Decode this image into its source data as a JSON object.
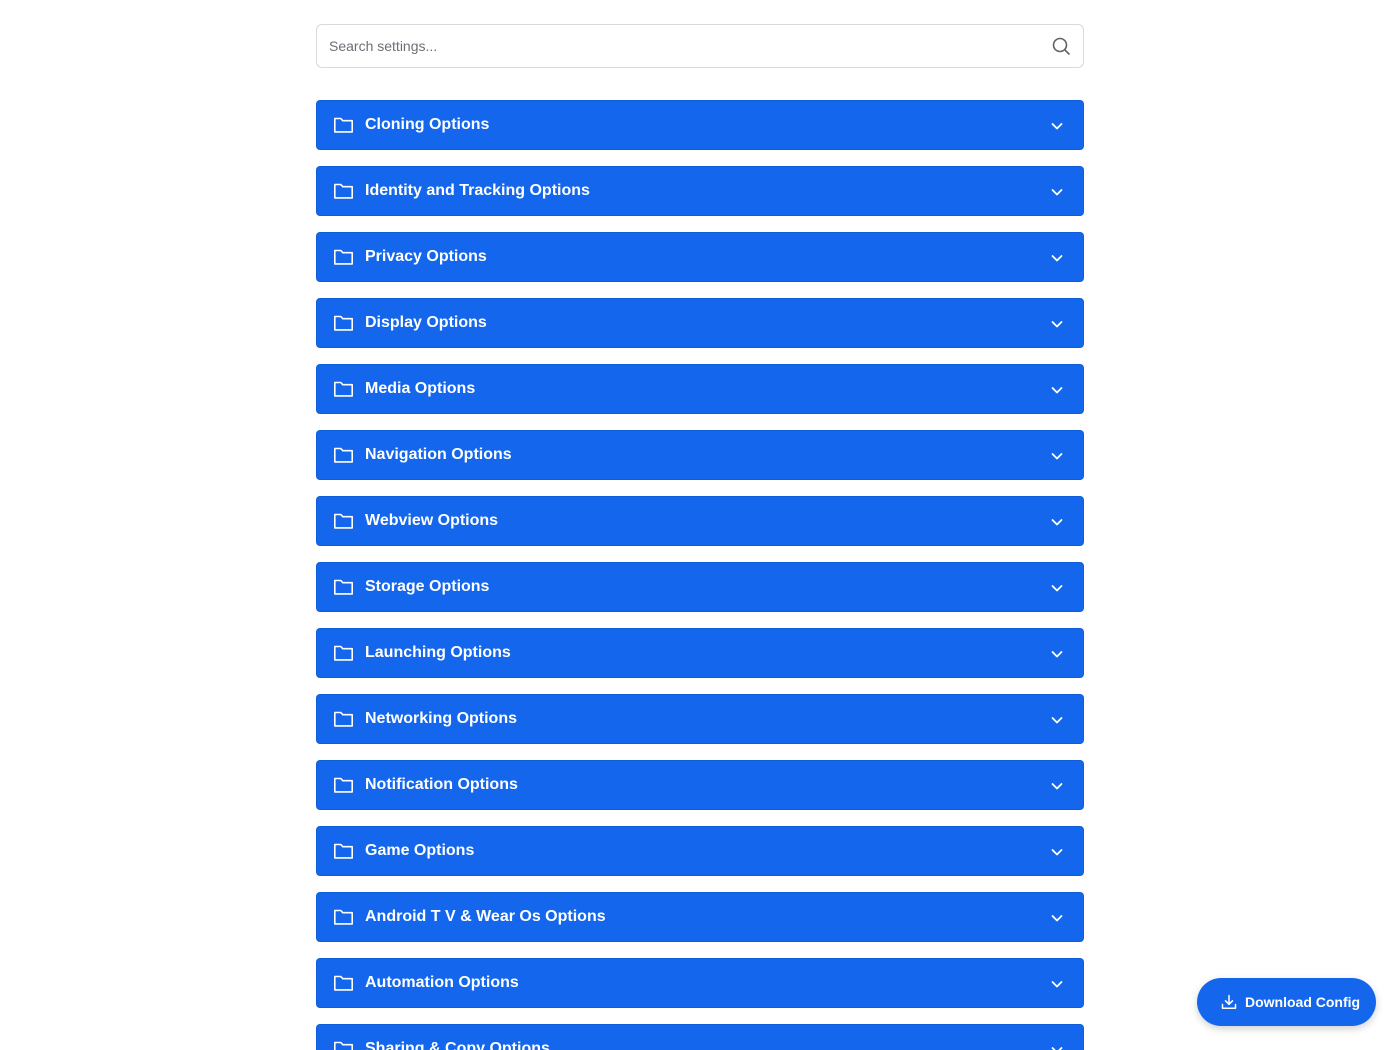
{
  "search": {
    "placeholder": "Search settings...",
    "value": "",
    "icon": "search-icon"
  },
  "sections": [
    {
      "label": "Cloning Options",
      "icon": "folder-icon",
      "expanded": false
    },
    {
      "label": "Identity and Tracking Options",
      "icon": "folder-icon",
      "expanded": false
    },
    {
      "label": "Privacy Options",
      "icon": "folder-icon",
      "expanded": false
    },
    {
      "label": "Display Options",
      "icon": "folder-icon",
      "expanded": false
    },
    {
      "label": "Media Options",
      "icon": "folder-icon",
      "expanded": false
    },
    {
      "label": "Navigation Options",
      "icon": "folder-icon",
      "expanded": false
    },
    {
      "label": "Webview Options",
      "icon": "folder-icon",
      "expanded": false
    },
    {
      "label": "Storage Options",
      "icon": "folder-icon",
      "expanded": false
    },
    {
      "label": "Launching Options",
      "icon": "folder-icon",
      "expanded": false
    },
    {
      "label": "Networking Options",
      "icon": "folder-icon",
      "expanded": false
    },
    {
      "label": "Notification Options",
      "icon": "folder-icon",
      "expanded": false
    },
    {
      "label": "Game Options",
      "icon": "folder-icon",
      "expanded": false
    },
    {
      "label": "Android T V & Wear Os Options",
      "icon": "folder-icon",
      "expanded": false
    },
    {
      "label": "Automation Options",
      "icon": "folder-icon",
      "expanded": false
    },
    {
      "label": "Sharing & Copy Options",
      "icon": "folder-icon",
      "expanded": false
    }
  ],
  "download_button": {
    "label": "Download Config",
    "icon": "download-icon"
  },
  "colors": {
    "accent": "#1467ec",
    "text_on_accent": "#ffffff",
    "page_background": "#ffffff",
    "search_border": "#d6d9de"
  }
}
